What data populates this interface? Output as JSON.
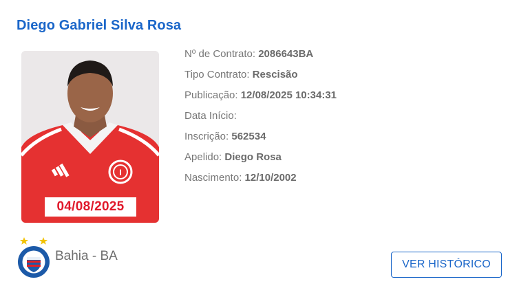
{
  "player": {
    "name": "Diego Gabriel Silva Rosa",
    "photo_date": "04/08/2025"
  },
  "details": [
    {
      "label": "Nº de Contrato: ",
      "value": "2086643BA"
    },
    {
      "label": "Tipo Contrato: ",
      "value": "Rescisão"
    },
    {
      "label": "Publicação: ",
      "value": "12/08/2025 10:34:31"
    },
    {
      "label": "Data Início: ",
      "value": ""
    },
    {
      "label": "Inscrição: ",
      "value": "562534"
    },
    {
      "label": "Apelido: ",
      "value": "Diego Rosa"
    },
    {
      "label": "Nascimento: ",
      "value": "12/10/2002"
    }
  ],
  "club": {
    "name": "Bahia - BA",
    "crest_icon": "esporte-clube-bahia-crest-icon",
    "crest_text": "ESPORTE CLUBE BAHIA"
  },
  "actions": {
    "history_label": "VER HISTÓRICO"
  },
  "colors": {
    "accent": "#1a66c9",
    "stamp": "#e0192b",
    "label": "#777777"
  }
}
